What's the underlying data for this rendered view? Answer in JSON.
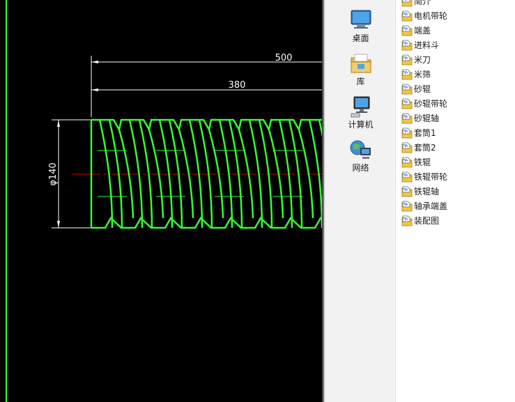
{
  "cad": {
    "dimensions": {
      "overall_length": "500",
      "thread_length": "380",
      "diameter": "φ140"
    },
    "colors": {
      "background": "#000000",
      "outline": "#33ff33",
      "dimension": "#ffffff",
      "centerline": "#cc0000"
    }
  },
  "nav": {
    "items": [
      {
        "label": "桌面",
        "icon": "desktop-icon"
      },
      {
        "label": "库",
        "icon": "library-icon"
      },
      {
        "label": "计算机",
        "icon": "computer-icon"
      },
      {
        "label": "网络",
        "icon": "network-icon"
      }
    ]
  },
  "files": {
    "icon": "cad-file-icon",
    "items": [
      "简介",
      "电机带轮",
      "端盖",
      "进料斗",
      "米刀",
      "米筛",
      "砂辊",
      "砂辊带轮",
      "砂辊轴",
      "套筒1",
      "套筒2",
      "铁辊",
      "铁辊带轮",
      "铁辊轴",
      "轴承端盖",
      "装配图"
    ]
  }
}
